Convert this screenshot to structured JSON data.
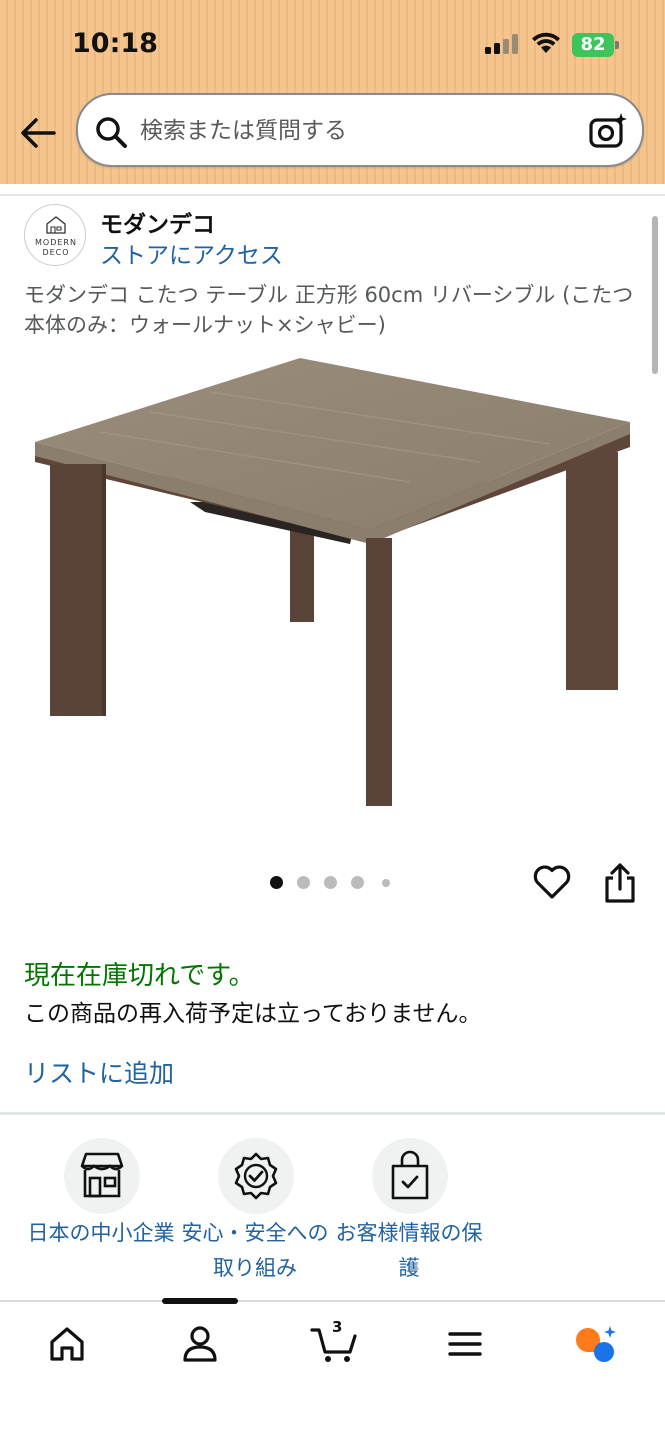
{
  "status_bar": {
    "time": "10:18",
    "battery": "82"
  },
  "search": {
    "placeholder": "検索または質問する"
  },
  "store": {
    "name": "モダンデコ",
    "link": "ストアにアクセス",
    "logo_text_line1": "MODERN",
    "logo_text_line2": "DECO"
  },
  "product": {
    "title": "モダンデコ こたつ テーブル 正方形 60cm リバーシブル (こたつ本体のみ：ウォールナット×シャビー)",
    "image_count": 5,
    "current_image": 1
  },
  "availability": {
    "status": "現在在庫切れです。",
    "note": "この商品の再入荷予定は立っておりません。",
    "add_to_list": "リストに追加"
  },
  "features": [
    {
      "icon": "storefront-icon",
      "label": "日本の中小企業"
    },
    {
      "icon": "shield-check-icon",
      "label": "安心・安全への取り組み"
    },
    {
      "icon": "shopping-bag-check-icon",
      "label": "お客様情報の保護"
    }
  ],
  "bottom_nav": {
    "items": [
      "home-icon",
      "account-icon",
      "cart-icon",
      "menu-icon",
      "rufus-assistant-icon"
    ],
    "cart_count": "3"
  },
  "colors": {
    "header_bg": "#f4c58e",
    "link": "#2162a1",
    "in_stock_green": "#007600",
    "battery_green": "#3dc55b"
  }
}
